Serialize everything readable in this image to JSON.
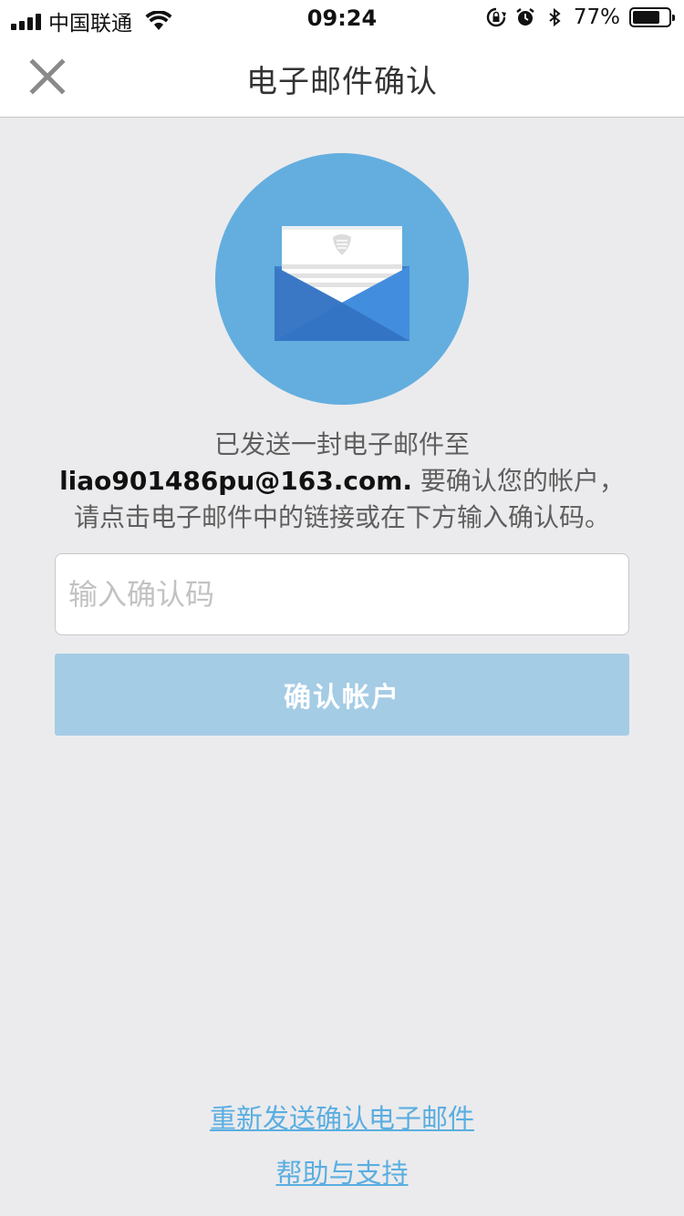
{
  "status_bar": {
    "carrier": "中国联通",
    "time": "09:24",
    "battery_percent": "77%",
    "battery_level": 0.77,
    "icons": [
      "signal-icon",
      "wifi-icon",
      "orientation-lock-icon",
      "alarm-icon",
      "bluetooth-icon",
      "battery-icon"
    ]
  },
  "nav": {
    "title": "电子邮件确认",
    "close_icon": "close-icon"
  },
  "hero": {
    "icon": "envelope-icon",
    "circle_color": "#63aedf"
  },
  "message": {
    "line1": "已发送一封电子邮件至",
    "email": "liao901486pu@163.com.",
    "line2_suffix": " 要确认您的帐户，",
    "line3": "请点击电子邮件中的链接或在下方输入确认码。"
  },
  "form": {
    "code_placeholder": "输入确认码",
    "code_value": "",
    "confirm_label": "确认帐户",
    "confirm_color": "#a5cce5"
  },
  "footer": {
    "resend_label": "重新发送确认电子邮件",
    "help_label": "帮助与支持",
    "link_color": "#5aaee0"
  }
}
